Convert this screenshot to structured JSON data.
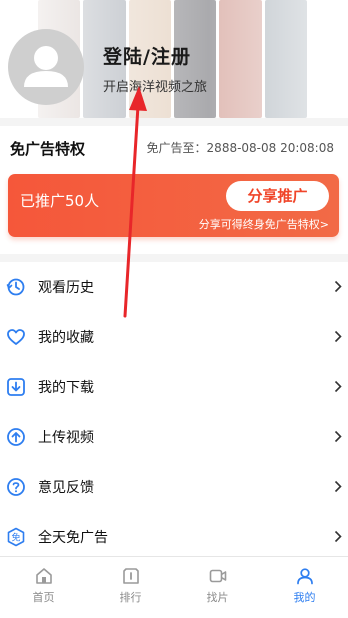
{
  "header": {
    "login_title": "登陆/注册",
    "login_subtitle": "开启海洋视频之旅"
  },
  "vip": {
    "title": "免广告特权",
    "expire_text": "免广告至：2888-08-08 20:08:08",
    "promo_count": "已推广50人",
    "share_button": "分享推广",
    "share_hint": "分享可得终身免广告特权>"
  },
  "menu": {
    "items": [
      {
        "label": "观看历史",
        "icon": "history-icon"
      },
      {
        "label": "我的收藏",
        "icon": "favorite-heart-icon"
      },
      {
        "label": "我的下载",
        "icon": "download-icon"
      },
      {
        "label": "上传视频",
        "icon": "upload-icon"
      },
      {
        "label": "意见反馈",
        "icon": "feedback-question-icon"
      },
      {
        "label": "全天免广告",
        "icon": "ad-free-icon"
      }
    ]
  },
  "tabbar": {
    "tabs": [
      {
        "label": "首页",
        "icon": "home-icon"
      },
      {
        "label": "排行",
        "icon": "ranking-icon"
      },
      {
        "label": "找片",
        "icon": "video-search-icon"
      },
      {
        "label": "我的",
        "icon": "profile-icon",
        "active": true
      }
    ]
  },
  "colors": {
    "accent_blue": "#2e7ef0",
    "promo_red": "#f5573a",
    "annotation_red": "#e8262a"
  }
}
